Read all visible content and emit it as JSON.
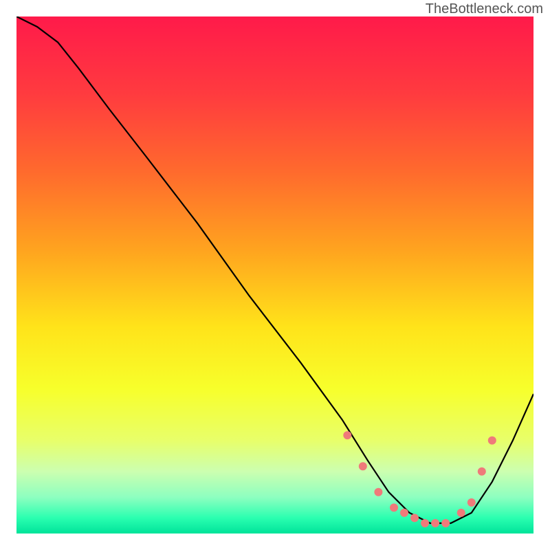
{
  "watermark": "TheBottleneck.com",
  "chart_data": {
    "type": "line",
    "title": "",
    "xlabel": "",
    "ylabel": "",
    "xlim": [
      0,
      100
    ],
    "ylim": [
      0,
      100
    ],
    "grid": false,
    "legend": false,
    "background_gradient_stops": [
      {
        "offset": 0.0,
        "color": "#ff1a4a"
      },
      {
        "offset": 0.15,
        "color": "#ff3b3f"
      },
      {
        "offset": 0.3,
        "color": "#ff6a2d"
      },
      {
        "offset": 0.45,
        "color": "#ffa31f"
      },
      {
        "offset": 0.6,
        "color": "#ffe31a"
      },
      {
        "offset": 0.72,
        "color": "#f7ff2b"
      },
      {
        "offset": 0.82,
        "color": "#e8ff6a"
      },
      {
        "offset": 0.88,
        "color": "#ccffb0"
      },
      {
        "offset": 0.93,
        "color": "#8dffc0"
      },
      {
        "offset": 0.97,
        "color": "#2affb0"
      },
      {
        "offset": 1.0,
        "color": "#00e39a"
      }
    ],
    "series": [
      {
        "name": "bottleneck-curve",
        "color": "#000000",
        "x": [
          0,
          4,
          8,
          12,
          18,
          25,
          35,
          45,
          55,
          63,
          68,
          72,
          76,
          80,
          84,
          88,
          92,
          96,
          100
        ],
        "y": [
          100,
          98,
          95,
          90,
          82,
          73,
          60,
          46,
          33,
          22,
          14,
          8,
          4,
          2,
          2,
          4,
          10,
          18,
          27
        ]
      }
    ],
    "markers": {
      "name": "valley-markers",
      "color": "#ef7a7a",
      "radius": 6,
      "x": [
        64,
        67,
        70,
        73,
        75,
        77,
        79,
        81,
        83,
        86,
        88,
        90,
        92
      ],
      "y": [
        19,
        13,
        8,
        5,
        4,
        3,
        2,
        2,
        2,
        4,
        6,
        12,
        18
      ]
    }
  }
}
